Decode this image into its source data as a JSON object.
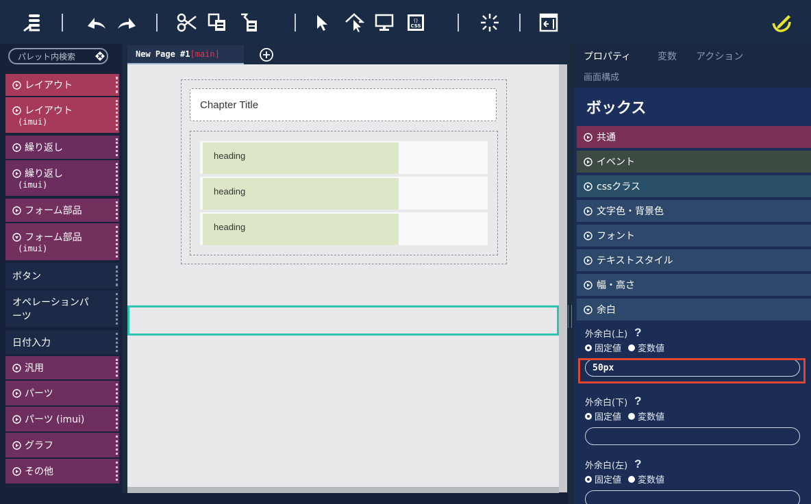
{
  "toolbar": {
    "buttons": [
      "structure-icon",
      "undo-icon",
      "redo-icon",
      "cut-icon",
      "copy-icon",
      "paste-icon",
      "select-icon",
      "select-parent-icon",
      "preview-icon",
      "css-icon",
      "sparkle-icon",
      "window-icon",
      "edit-check-icon"
    ],
    "css_label": "CSS"
  },
  "palette": {
    "search_placeholder": "パレット内検索",
    "items": [
      {
        "label": "レイアウト",
        "sub": "",
        "expanded": false,
        "color": "#a63a58"
      },
      {
        "label": "レイアウト",
        "sub": "(imui)",
        "expanded": false,
        "color": "#a63a58"
      },
      {
        "label": "繰り返し",
        "sub": "",
        "expanded": false,
        "color": "#6b2c5e"
      },
      {
        "label": "繰り返し",
        "sub": "(imui)",
        "expanded": false,
        "color": "#6b2c5e"
      },
      {
        "label": "フォーム部品",
        "sub": "",
        "expanded": false,
        "color": "#73305f"
      },
      {
        "label": "フォーム部品",
        "sub": "(imui)",
        "expanded": true,
        "color": "#73305f"
      },
      {
        "label": "ボタン",
        "sub": "",
        "plain": true
      },
      {
        "label": "オペレーションパ",
        "sub": "ーツ",
        "plain": true
      },
      {
        "label": "日付入力",
        "sub": "",
        "plain": true
      },
      {
        "label": "汎用",
        "sub": "",
        "expanded": false,
        "color": "#6e2f5e"
      },
      {
        "label": "パーツ",
        "sub": "",
        "expanded": false,
        "color": "#6e2f5e"
      },
      {
        "label": "パーツ (imui)",
        "sub": "",
        "expanded": false,
        "color": "#6e2f5e"
      },
      {
        "label": "グラフ",
        "sub": "",
        "expanded": false,
        "color": "#6e2f5e"
      },
      {
        "label": "その他",
        "sub": "",
        "expanded": false,
        "color": "#6e2f5e"
      }
    ]
  },
  "editor": {
    "tab_label": "New Page #1",
    "tab_suffix": "[main]",
    "chapter_title": "Chapter Title",
    "rows": [
      "heading",
      "heading",
      "heading"
    ]
  },
  "properties": {
    "tabs": [
      "プロパティ",
      "変数",
      "アクション"
    ],
    "subtab": "画面構成",
    "title": "ボックス",
    "sections": [
      {
        "label": "共通",
        "color": "#7a2f55",
        "expanded": false
      },
      {
        "label": "イベント",
        "color": "#3d4a42",
        "expanded": false
      },
      {
        "label": "cssクラス",
        "color": "#2a4f68",
        "expanded": false
      },
      {
        "label": "文字色・背景色",
        "color": "#2d486b",
        "expanded": false
      },
      {
        "label": "フォント",
        "color": "#2d486b",
        "expanded": false
      },
      {
        "label": "テキストスタイル",
        "color": "#2d486b",
        "expanded": false
      },
      {
        "label": "幅・高さ",
        "color": "#2d486b",
        "expanded": false
      },
      {
        "label": "余白",
        "color": "#2d486b",
        "expanded": true
      }
    ],
    "fields": [
      {
        "label": "外余白(上)",
        "help": "?",
        "fixed": "固定値",
        "variable": "変数値",
        "value": "50px"
      },
      {
        "label": "外余白(下)",
        "help": "?",
        "fixed": "固定値",
        "variable": "変数値",
        "value": ""
      },
      {
        "label": "外余白(左)",
        "help": "?",
        "fixed": "固定値",
        "variable": "変数値",
        "value": ""
      }
    ]
  },
  "colors": {
    "accent_teal": "#2ec4b1",
    "highlight_red": "#e0452f",
    "tab_main_red": "#e3364c"
  }
}
